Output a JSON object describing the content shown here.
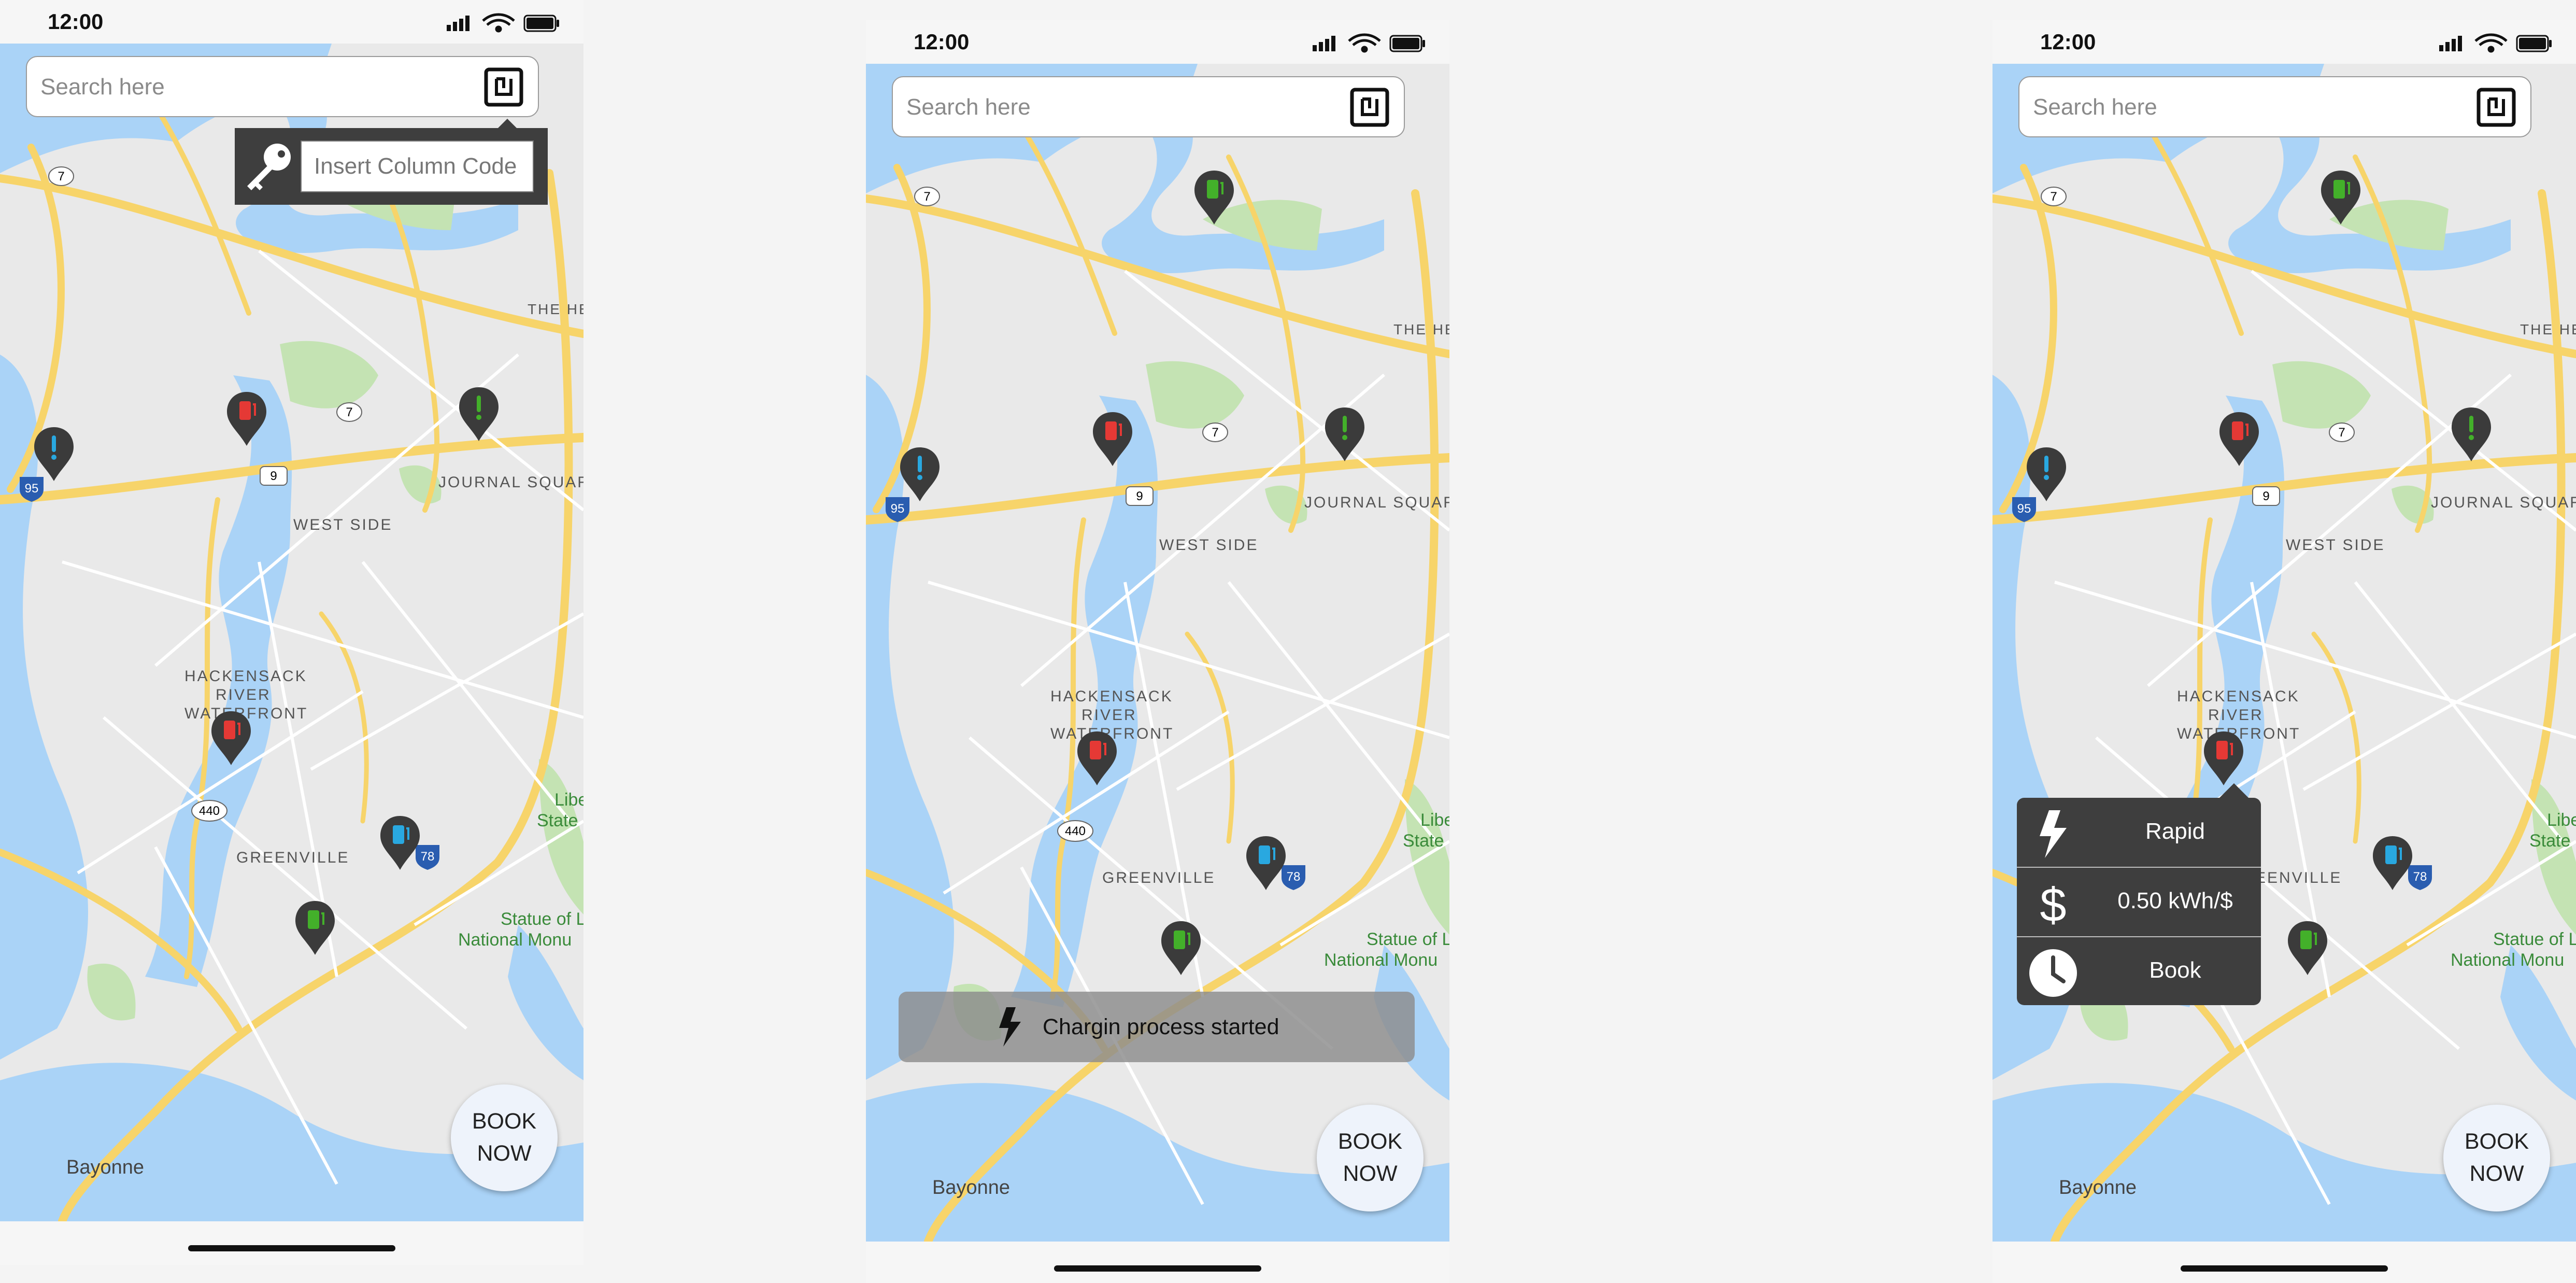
{
  "status_bar": {
    "time": "12:00"
  },
  "search": {
    "placeholder": "Search here"
  },
  "column_code": {
    "placeholder": "Insert Column Code"
  },
  "book_button": {
    "line1": "BOOK",
    "line2": "NOW"
  },
  "toast": {
    "message": "Chargin process started"
  },
  "station_info": {
    "speed": "Rapid",
    "price": "0.50 kWh/$",
    "book": "Book"
  },
  "map_labels": {
    "the_heights": "THE HE",
    "journal_square": "JOURNAL SQUARE",
    "west_side": "WEST SIDE",
    "hackensack_1": "HACKENSACK",
    "hackensack_2": "RIVER",
    "hackensack_3": "WATERFRONT",
    "greenville": "GREENVILLE",
    "liberty_1": "Libe",
    "liberty_2": "State",
    "statue_1": "Statue of L",
    "statue_2": "National Monu",
    "bayonne": "Bayonne",
    "route_7": "7",
    "route_9": "9",
    "route_95": "95",
    "route_440": "440",
    "route_78": "78"
  },
  "colors": {
    "pin_body": "#3b3b3b",
    "pin_red": "#e53935",
    "pin_green": "#43b02a",
    "pin_blue": "#29a8e0",
    "panel": "#3e3e3e",
    "water": "#aad3f7",
    "park": "#c4e3b3",
    "road": "#f7d46a"
  },
  "icons": [
    "signal-icon",
    "wifi-icon",
    "battery-icon",
    "nfc-icon",
    "key-icon",
    "bolt-icon",
    "dollar-icon",
    "clock-icon",
    "charging-station-pin-icon",
    "alert-pin-icon"
  ]
}
